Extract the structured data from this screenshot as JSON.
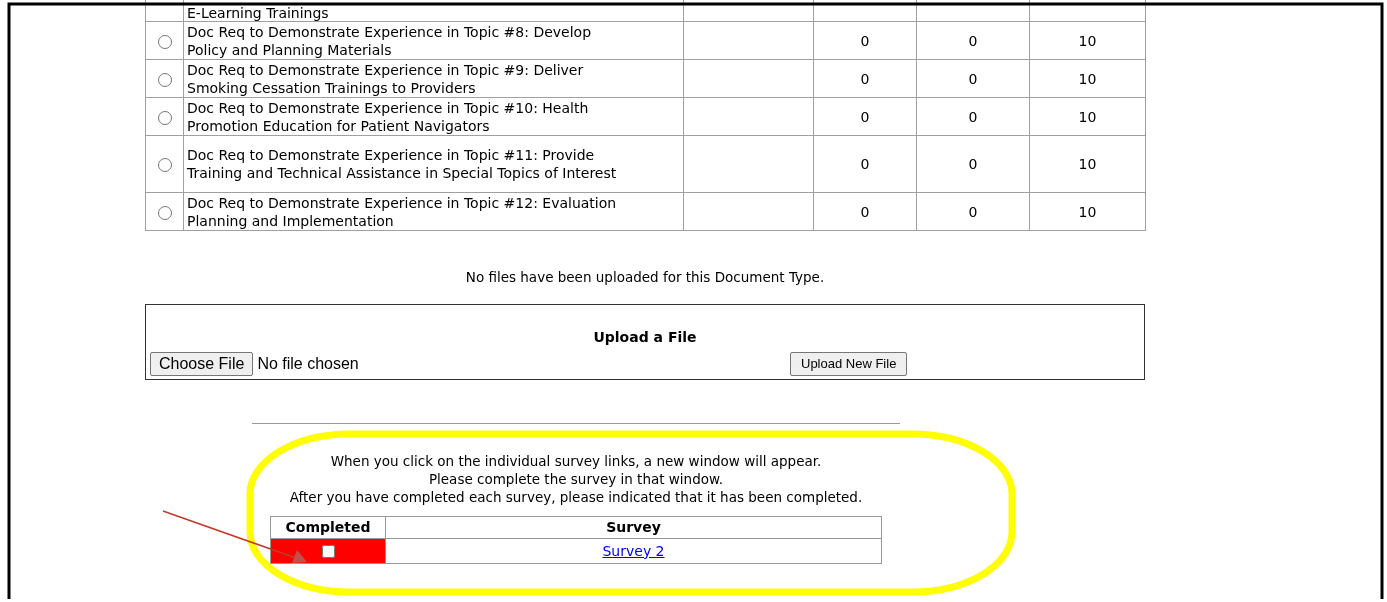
{
  "document_table": {
    "partial_row": {
      "description": "E-Learning Trainings"
    },
    "rows": [
      {
        "selected": false,
        "description": "Doc Req to Demonstrate Experience in Topic #8: Develop Policy and Planning Materials",
        "column_4": "0",
        "column_5": "0",
        "column_6": "10"
      },
      {
        "selected": false,
        "description": "Doc Req to Demonstrate Experience in Topic #9: Deliver Smoking Cessation Trainings to Providers",
        "column_4": "0",
        "column_5": "0",
        "column_6": "10"
      },
      {
        "selected": false,
        "description": "Doc Req to Demonstrate Experience in Topic #10: Health Promotion Education for Patient Navigators",
        "column_4": "0",
        "column_5": "0",
        "column_6": "10"
      },
      {
        "selected": false,
        "description": "Doc Req to Demonstrate Experience in Topic #11: Provide Training and Technical Assistance in Special Topics of Interest",
        "column_4": "0",
        "column_5": "0",
        "column_6": "10"
      },
      {
        "selected": false,
        "description": "Doc Req to Demonstrate Experience in Topic #12: Evaluation Planning and Implementation",
        "column_4": "0",
        "column_5": "0",
        "column_6": "10"
      }
    ]
  },
  "no_files_message": "No files have been uploaded for this Document Type.",
  "upload": {
    "title": "Upload a File",
    "choose_button": "Choose File",
    "file_status": "No file chosen",
    "upload_button": "Upload New File"
  },
  "instructions": [
    "When you click on the individual survey links, a new window will appear.",
    "Please complete the survey in that window.",
    "After you have completed each survey, please indicated that it has been completed."
  ],
  "survey_table": {
    "columns": [
      "Completed",
      "Survey"
    ],
    "rows": [
      {
        "checked": false,
        "color": "#ff0000",
        "survey": "Survey 2"
      }
    ]
  }
}
